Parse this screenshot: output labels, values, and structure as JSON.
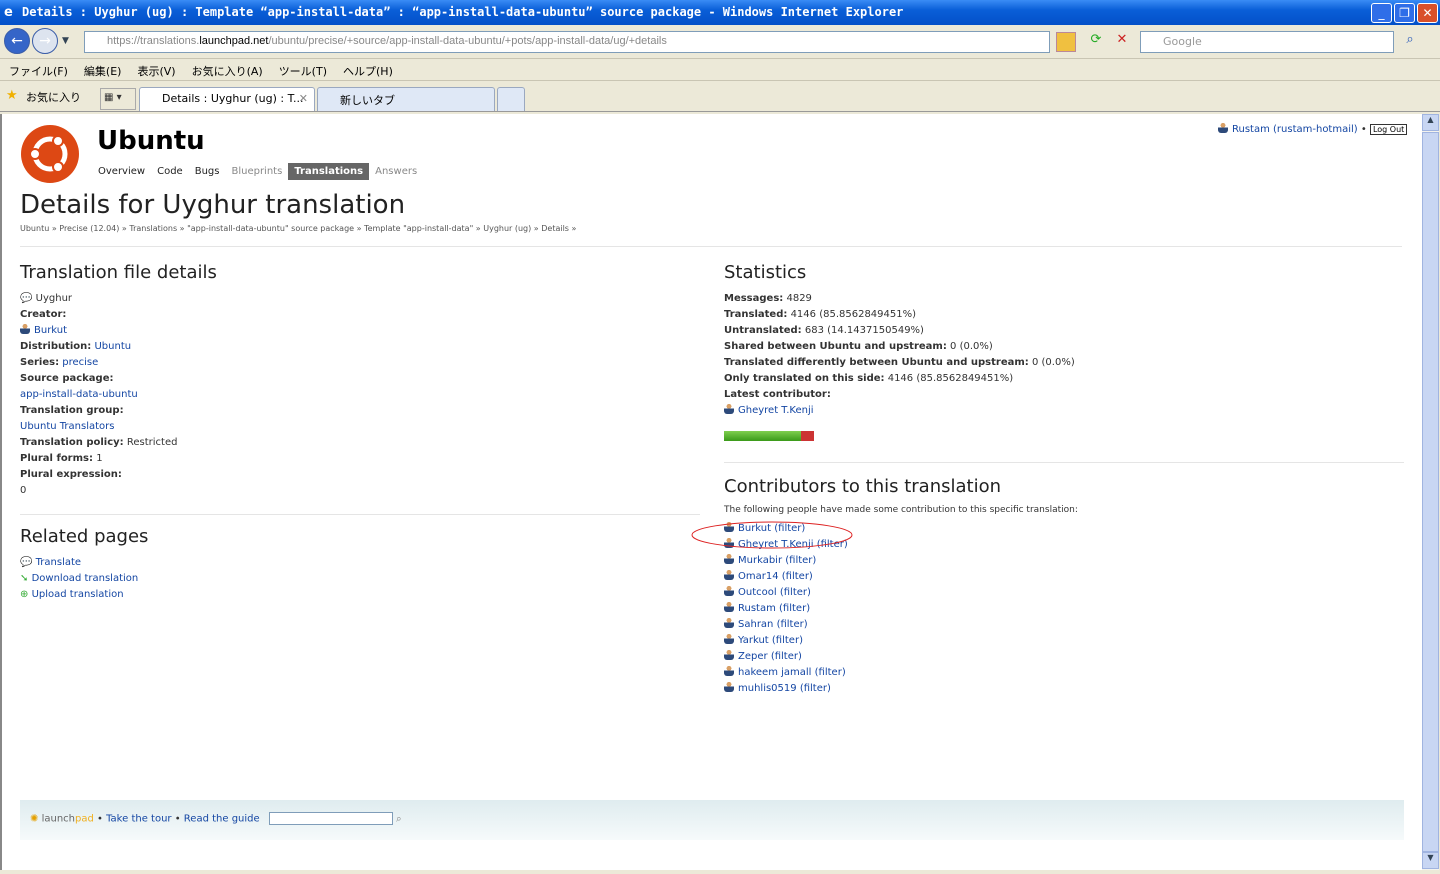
{
  "window": {
    "title": "Details : Uyghur (ug) : Template “app-install-data” : “app-install-data-ubuntu” source package  - Windows Internet Explorer"
  },
  "browser": {
    "url_prefix": "https://translations.",
    "url_host": "launchpad.net",
    "url_path": "/ubuntu/precise/+source/app-install-data-ubuntu/+pots/app-install-data/ug/+details",
    "search_placeholder": "Google",
    "menu": [
      "ファイル(F)",
      "編集(E)",
      "表示(V)",
      "お気に入り(A)",
      "ツール(T)",
      "ヘルプ(H)"
    ],
    "favorites": "お気に入り",
    "tabs": [
      "Details : Uyghur (ug) : T...",
      "新しいタブ"
    ]
  },
  "site": {
    "project": "Ubuntu",
    "nav": [
      "Overview",
      "Code",
      "Bugs",
      "Blueprints",
      "Translations",
      "Answers"
    ],
    "active_nav": "Translations",
    "user": "Rustam (rustam-hotmail)",
    "logout": "Log Out"
  },
  "page": {
    "title": "Details for Uyghur translation",
    "breadcrumb": "Ubuntu » Precise (12.04) » Translations » \"app-install-data-ubuntu\" source package » Template \"app-install-data\" » Uyghur (ug) » Details »"
  },
  "file_details": {
    "heading": "Translation file details",
    "language": "Uyghur",
    "creator_label": "Creator:",
    "creator": "Burkut",
    "distribution_label": "Distribution:",
    "distribution": "Ubuntu",
    "series_label": "Series:",
    "series": "precise",
    "source_label": "Source package:",
    "source": "app-install-data-ubuntu",
    "group_label": "Translation group:",
    "group": "Ubuntu Translators",
    "policy_label": "Translation policy:",
    "policy": "Restricted",
    "plural_forms_label": "Plural forms:",
    "plural_forms": "1",
    "plural_expr_label": "Plural expression:",
    "plural_expr": "0"
  },
  "related": {
    "heading": "Related pages",
    "links": [
      "Translate",
      "Download translation",
      "Upload translation"
    ]
  },
  "statistics": {
    "heading": "Statistics",
    "rows": [
      {
        "label": "Messages:",
        "value": "4829"
      },
      {
        "label": "Translated:",
        "value": "4146 (85.8562849451%)"
      },
      {
        "label": "Untranslated:",
        "value": "683 (14.1437150549%)"
      },
      {
        "label": "Shared between Ubuntu and upstream:",
        "value": "0 (0.0%)"
      },
      {
        "label": "Translated differently between Ubuntu and upstream:",
        "value": "0 (0.0%)"
      },
      {
        "label": "Only translated on this side:",
        "value": "4146 (85.8562849451%)"
      }
    ],
    "latest_label": "Latest contributor:",
    "latest": "Gheyret T.Kenji",
    "translated_percent": 85.86
  },
  "contributors": {
    "heading": "Contributors to this translation",
    "intro": "The following people have made some contribution to this specific translation:",
    "filter": "(filter)",
    "names": [
      "Burkut",
      "Gheyret T.Kenji",
      "Murkabir",
      "Omar14",
      "Outcool",
      "Rustam",
      "Sahran",
      "Yarkut",
      "Zeper",
      "hakeem jamall",
      "muhlis0519"
    ]
  },
  "footer": {
    "logo": "launchpad",
    "tour": "Take the tour",
    "guide": "Read the guide"
  }
}
